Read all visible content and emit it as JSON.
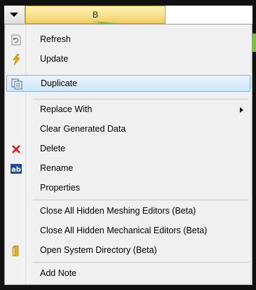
{
  "header": {
    "column_label": "B"
  },
  "menu": {
    "items": [
      {
        "label": "Refresh",
        "icon": "refresh-icon"
      },
      {
        "label": "Update",
        "icon": "lightning-icon"
      },
      {
        "label": "Duplicate",
        "icon": "duplicate-icon"
      },
      {
        "label": "Replace With",
        "icon": ""
      },
      {
        "label": "Clear Generated Data",
        "icon": ""
      },
      {
        "label": "Delete",
        "icon": "delete-x-icon"
      },
      {
        "label": "Rename",
        "icon": "rename-icon"
      },
      {
        "label": "Properties",
        "icon": ""
      },
      {
        "label": "Close All Hidden Meshing Editors (Beta)",
        "icon": ""
      },
      {
        "label": "Close All Hidden Mechanical Editors (Beta)",
        "icon": ""
      },
      {
        "label": "Open System Directory (Beta)",
        "icon": "folder-icon"
      },
      {
        "label": "Add Note",
        "icon": ""
      }
    ]
  },
  "colors": {
    "highlight": "#d3e6fa",
    "highlight_border": "#7fb0e6",
    "header_yellow": "#f2cf64",
    "delete_red": "#e01010",
    "connector_green": "#7ac142"
  }
}
